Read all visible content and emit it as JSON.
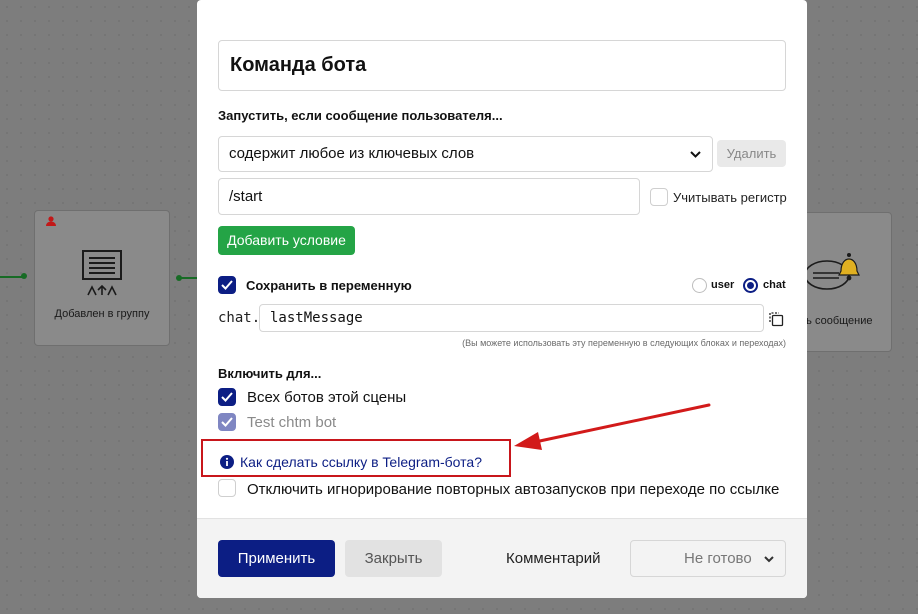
{
  "canvas": {
    "left_node_label": "Добавлен в группу",
    "right_node_label": "ить сообщение"
  },
  "modal": {
    "title": "Команда бота",
    "trigger_label": "Запустить, если сообщение пользователя...",
    "condition_select": "содержит любое из ключевых слов",
    "delete_button": "Удалить",
    "keyword_value": "/start",
    "case_sensitive_label": "Учитывать регистр",
    "case_sensitive_checked": false,
    "add_condition_button": "Добавить условие",
    "save_to_variable_label": "Сохранить в переменную",
    "save_to_variable_checked": true,
    "scope_options": [
      {
        "label": "user",
        "selected": false
      },
      {
        "label": "chat",
        "selected": true
      }
    ],
    "variable_prefix": "chat.",
    "variable_name": "lastMessage",
    "variable_hint": "(Вы можете использовать эту переменную в следующих блоках и переходах)",
    "enable_for_label": "Включить для...",
    "enable_options": [
      {
        "label": "Всех ботов этой сцены",
        "checked": true
      },
      {
        "label": "Test chtm bot",
        "checked": true,
        "disabled": true
      }
    ],
    "help_link": "Как сделать ссылку в Telegram-бота?",
    "disable_ignore_label": "Отключить игнорирование повторных автозапусков при переходе по ссылке",
    "disable_ignore_checked": false
  },
  "footer": {
    "apply_button": "Применить",
    "close_button": "Закрыть",
    "comment_label": "Комментарий",
    "status_value": "Не готово"
  },
  "colors": {
    "primary": "#0c1e84",
    "green": "#24a446",
    "annotation_red": "#d21a1a"
  }
}
